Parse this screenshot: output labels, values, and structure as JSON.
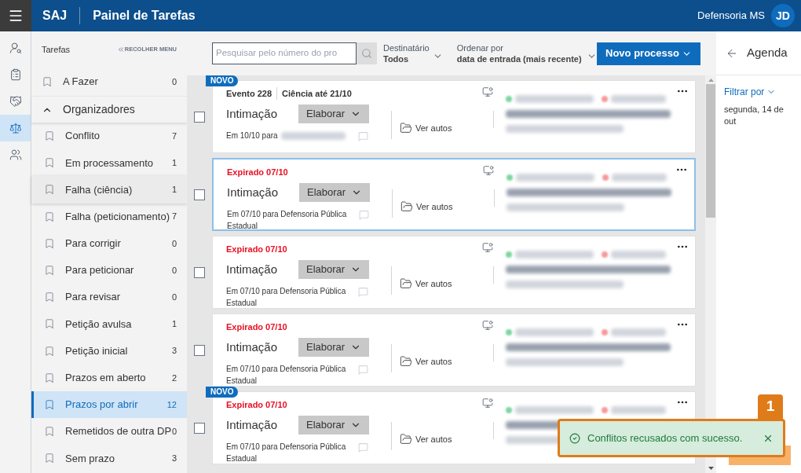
{
  "header": {
    "app": "SAJ",
    "title": "Painel de Tarefas",
    "user": "Defensoria MS",
    "avatar": "JD"
  },
  "rail": [
    {
      "kind": "person",
      "selected": false
    },
    {
      "kind": "clipboard",
      "selected": false
    },
    {
      "kind": "handshake",
      "selected": false
    },
    {
      "kind": "scales",
      "selected": true
    },
    {
      "kind": "group",
      "selected": false
    }
  ],
  "sidebar": {
    "title": "Tarefas",
    "collapse": "RECOLHER MENU",
    "top_item": {
      "label": "A Fazer",
      "count": "0"
    },
    "group": {
      "label": "Organizadores",
      "expanded": true
    },
    "items": [
      {
        "label": "Conflito",
        "count": "7",
        "selected": false,
        "hovered": false
      },
      {
        "label": "Em processamento",
        "count": "1",
        "selected": false,
        "hovered": false
      },
      {
        "label": "Falha (ciência)",
        "count": "1",
        "selected": false,
        "hovered": true
      },
      {
        "label": "Falha (peticionamento)",
        "count": "7",
        "selected": false,
        "hovered": false
      },
      {
        "label": "Para corrigir",
        "count": "0",
        "selected": false,
        "hovered": false
      },
      {
        "label": "Para peticionar",
        "count": "0",
        "selected": false,
        "hovered": false
      },
      {
        "label": "Para revisar",
        "count": "0",
        "selected": false,
        "hovered": false
      },
      {
        "label": "Petição avulsa",
        "count": "1",
        "selected": false,
        "hovered": false
      },
      {
        "label": "Petição inicial",
        "count": "3",
        "selected": false,
        "hovered": false
      },
      {
        "label": "Prazos em aberto",
        "count": "2",
        "selected": false,
        "hovered": false
      },
      {
        "label": "Prazos por abrir",
        "count": "12",
        "selected": true,
        "hovered": false
      },
      {
        "label": "Remetidos de outra DP",
        "count": "0",
        "selected": false,
        "hovered": false
      },
      {
        "label": "Sem prazo",
        "count": "3",
        "selected": false,
        "hovered": false
      }
    ]
  },
  "toolbar": {
    "search": {
      "placeholder": "Pesquisar pelo número do pro"
    },
    "recipient": {
      "label": "Destinatário",
      "value": "Todos"
    },
    "order": {
      "label": "Ordenar por",
      "value": "data de entrada (mais recente)"
    },
    "new_button": "Novo processo"
  },
  "cards": [
    {
      "kind": "event",
      "new": true,
      "badge": "NOVO",
      "event": "Evento 228",
      "deadline": "Ciência até 21/10",
      "type": "Intimação",
      "action": "Elaborar",
      "link": "Ver autos",
      "received": "Em 10/10 para",
      "checked": false,
      "selected": false
    },
    {
      "kind": "expired",
      "new": false,
      "status": "Expirado 07/10",
      "type": "Intimação",
      "action": "Elaborar",
      "link": "Ver autos",
      "received": "Em 07/10 para Defensoria Pública Estadual",
      "checked": false,
      "selected": true
    },
    {
      "kind": "expired",
      "new": false,
      "status": "Expirado 07/10",
      "type": "Intimação",
      "action": "Elaborar",
      "link": "Ver autos",
      "received": "Em 07/10 para Defensoria Pública Estadual",
      "checked": false,
      "selected": false
    },
    {
      "kind": "expired",
      "new": false,
      "status": "Expirado 07/10",
      "type": "Intimação",
      "action": "Elaborar",
      "link": "Ver autos",
      "received": "Em 07/10 para Defensoria Pública Estadual",
      "checked": false,
      "selected": false
    },
    {
      "kind": "expired",
      "new": true,
      "badge": "NOVO",
      "status": "Expirado 07/10",
      "type": "Intimação",
      "action": "Elaborar",
      "link": "Ver autos",
      "received": "Em 07/10 para Defensoria Pública Estadual",
      "checked": false,
      "selected": false
    }
  ],
  "agenda": {
    "title": "Agenda",
    "filter": "Filtrar por",
    "date": "segunda, 14 de out"
  },
  "toast": {
    "message": "Conflitos recusados com sucesso.",
    "step": "1"
  }
}
